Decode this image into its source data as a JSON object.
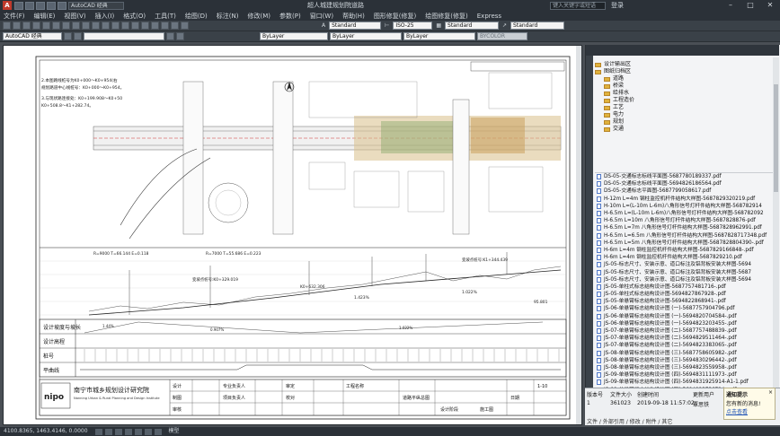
{
  "app": {
    "window_title": "超人城建规划院道路",
    "search_placeholder": "键入关键字或短语",
    "login_label": "登录",
    "workspace": "AutoCAD 经典"
  },
  "menu": [
    "文件(F)",
    "编辑(E)",
    "视图(V)",
    "插入(I)",
    "格式(O)",
    "工具(T)",
    "绘图(D)",
    "标注(N)",
    "修改(M)",
    "参数(P)",
    "窗口(W)",
    "帮助(H)",
    "图形修复(修复)",
    "绘图修复(修复)",
    "Express"
  ],
  "toolbar": {
    "workspace_dropdown": "AutoCAD 经典",
    "text_style": "Standard",
    "dim_style": "ISO-25",
    "table_style": "Standard",
    "mleader_style": "Standard",
    "layer_color": "ByLayer",
    "layer_linetype": "ByLayer",
    "layer_lineweight": "ByLayer",
    "plot_style": "BYCOLOR"
  },
  "drawing": {
    "notes": [
      "2.本图路线桩号为K0+000～K0+954(右幅里程)，规划路道中心线桩号：K0+000～K0+954。",
      "3.与现状路连接处：K0+199.908～K0+508.8，K0+508.8～K1+282.74。"
    ],
    "plan_labels": [
      "GS-05-交通标志标线平面图"
    ],
    "profile_labels": [
      "R=9000 T=66.144 E=0.118",
      "R=7000 T=55.686 E=0.223",
      "变坡点桩号:K0+329.019",
      "变坡点桩号:K1+344.439",
      "K0+632.306",
      "1.423%",
      "1.022%",
      "95.801"
    ],
    "profile_rows": [
      "设计坡度与坡长",
      "设计高程",
      "桩号",
      "平曲线"
    ],
    "profile_values": {
      "slope_left": "1.44%",
      "slope_mid": "0.907%",
      "slope_right": "1.022%",
      "lengths": [
        "150",
        "470",
        "1630",
        "1.022"
      ]
    },
    "titleblock": {
      "institute_cn": "南宁市城乡规划设计研究院",
      "institute_en": "Nanning Urban & Rural Planning and Design Institute",
      "roles": [
        "设计",
        "制图",
        "审核",
        "专业负责人",
        "项目负责人",
        "审定",
        "校对"
      ],
      "drawing_name": "道路平纵总图",
      "project_label": "工程名称",
      "stage_label": "设计阶段",
      "stage": "施工图",
      "sheet_no": "1-10",
      "date_label": "日期"
    }
  },
  "palette": {
    "folders": [
      "设计输出区",
      "图纸归档区",
      "道路",
      "桥梁",
      "给排水",
      "工程造价",
      "工艺",
      "电力",
      "规划",
      "交通"
    ],
    "files": [
      "DS-05-交通标志标线平面图-5687780189337.pdf",
      "DS-05-交通标志标线平面图-5694826186564.pdf",
      "DS-05-交通标志平面图-5687799058617.pdf",
      "H-12m L=4m 钢柱监控机杆件结构大样图-5687829320219.pdf",
      "H-10m L=(L-10m L-6m)八角形信号灯杆件结构大样图-568782914",
      "H-6.5m L=(L-10m L-6m)八角形信号灯杆件结构大样图-568782092",
      "H-6.5m L=10m 八角形信号灯杆件结构大样图-5687828876-pdf",
      "H-6.5m L=7m 八角形信号灯杆件结构大样图-5687828962991.pdf",
      "H-6.5m L=6.5m 八角形信号灯杆件结构大样图-5687828717348.pdf",
      "H-6.5m L=5m 八角形信号灯杆件结构大样图-5687828804390-.pdf",
      "H-6m L=4m 钢柱监控机杆件结构大样图-5687829166848-.pdf",
      "H-6m L=4m 钢柱监控机杆件结构大样图-5687829210.pdf",
      "JS-05-标志尺寸、安装示意、道口标注及铝背板安装大样图-5694",
      "JS-05-标志尺寸、安装示意、道口标注及铝背板安装大样图-5687",
      "JS-05-标志尺寸、安装示意、道口标注及铝背板安装大样图-5694",
      "JS-05-单柱式标志结构设计图-5687757481716-.pdf",
      "JS-05-单柱式标志结构设计图-5694827867928-.pdf",
      "JS-05-单悬臂标志结构设计图-5694822868941-.pdf",
      "JS-06-单悬臂标志结构设计图 (一)-5687757904796.pdf",
      "JS-06-单悬臂标志结构设计图 (一)-5694820704584-.pdf",
      "JS-06-单悬臂标志结构设计图 (一)-5694823203455-.pdf",
      "JS-07-单悬臂标志结构设计图 (二)-5687757488839-.pdf",
      "JS-07-单悬臂标志结构设计图 (二)-5694829511464-.pdf",
      "JS-07-单悬臂标志结构设计图 (二)-5694823383065-.pdf",
      "JS-08-单悬臂标志结构设计图 (三)-5687758605982-.pdf",
      "JS-08-单悬臂标志结构设计图 (三)-5694830296442-.pdf",
      "JS-08-单悬臂标志结构设计图 (三)-5694823559958-.pdf",
      "JS-09-单悬臂标志结构设计图 (四)-5694831111973-.pdf",
      "JS-09-单悬臂标志结构设计图 (四)-5694831925914-A1-1.pdf",
      "JS-09-单悬臂标志结构设计图 (四)-5694823736724-.pdf",
      "JS-10-双悬臂标志结构设计图 (一)-5694823927641-A1-1.pdf",
      "JS-10-双悬臂标志结构设计图 (一)-5687759341414-.pdf",
      "JS-10-双悬臂标志结构设计图 (一)-5694823736724-.pdf",
      "JS-10-双悬臂标志结构设计图 (一)-5694844119151-.pdf",
      "JS-11-双悬臂标志结构设计图 (一)-5687759725023-.pdf"
    ]
  },
  "detail": {
    "headers": [
      "版本号",
      "文件大小",
      "创建时间",
      "更新用户"
    ],
    "values": [
      "1",
      "361023",
      "2019-09-18 11:57:02",
      "覃思铁"
    ],
    "footer": "文件 / 外部引用 / 修改 / 附件 / 其它"
  },
  "notify": {
    "title": "通知提示",
    "message": "您有新的消息!",
    "link": "点击查看",
    "close": "×"
  },
  "status": {
    "coords": "4100.8365, 1463.4146, 0.0000",
    "mode": "模型"
  }
}
